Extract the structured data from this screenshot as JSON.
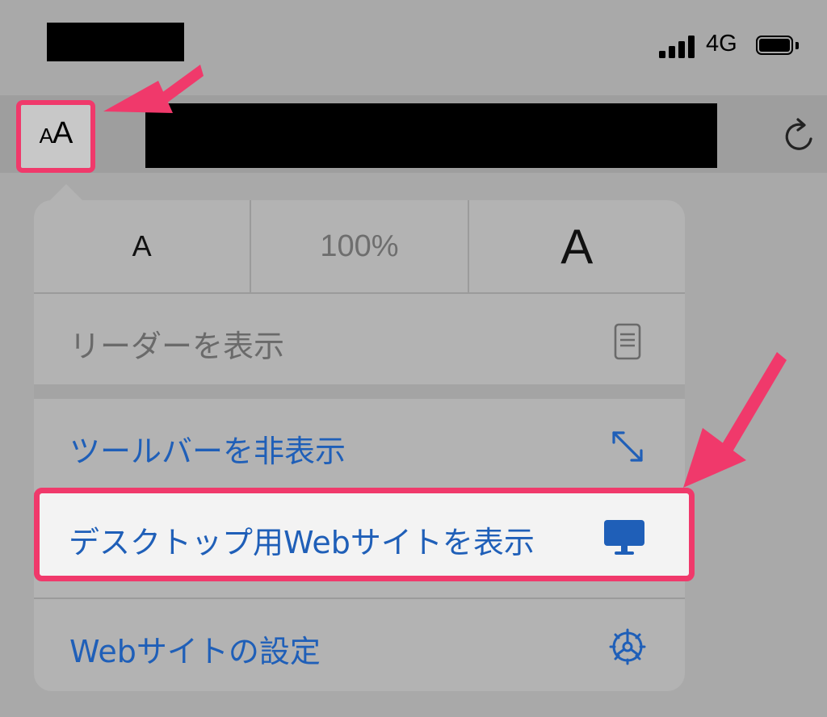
{
  "status_bar": {
    "network": "4G"
  },
  "toolbar": {
    "aa_button": {
      "small": "A",
      "large": "A"
    }
  },
  "menu": {
    "font_size": {
      "decrease": "A",
      "zoom": "100%",
      "increase": "A"
    },
    "items": [
      {
        "label": "リーダーを表示",
        "icon": "reader-doc-icon",
        "enabled": false
      },
      {
        "label": "ツールバーを非表示",
        "icon": "expand-arrows-icon",
        "enabled": true
      },
      {
        "label": "デスクトップ用Webサイトを表示",
        "icon": "desktop-monitor-icon",
        "enabled": true,
        "highlighted": true
      },
      {
        "label": "Webサイトの設定",
        "icon": "gear-icon",
        "enabled": true
      }
    ]
  },
  "colors": {
    "highlight": "#f0396b",
    "link": "#1f5fb8"
  }
}
